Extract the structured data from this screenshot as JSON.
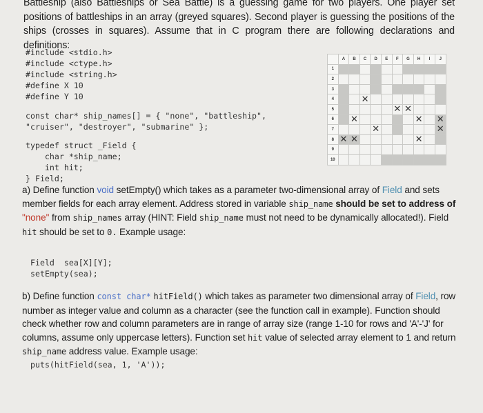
{
  "intro": [
    {
      "t": "Battleship (also Battleships or Sea Battle) is a guessing game for two players. One player set positions of battleships in an array (greyed squares). Second player is guessing the positions of the ships (crosses in squares). Assume that in C program there are following declarations and definitions:",
      "c": ""
    }
  ],
  "code_includes": "#include <stdio.h>\n#include <ctype.h>\n#include <string.h>\n#define X 10\n#define Y 10",
  "code_names": "const char* ship_names[] = { \"none\", \"battleship\",\n\"cruiser\", \"destroyer\", \"submarine\" };",
  "code_struct": "typedef struct _Field {\n    char *ship_name;\n    int hit;\n} Field;",
  "part_a": [
    {
      "t": "a) Define function ",
      "c": ""
    },
    {
      "t": "void",
      "c": "kw"
    },
    {
      "t": " setEmpty() which takes as a parameter two-dimensional array of ",
      "c": ""
    },
    {
      "t": "Field",
      "c": "ty"
    },
    {
      "t": " and sets member fields for each array element. Address stored in variable ",
      "c": ""
    },
    {
      "t": "ship_name",
      "c": "mono"
    },
    {
      "t": " should be set to address of",
      "c": "b"
    },
    {
      "t": " \"none\"",
      "c": "red"
    },
    {
      "t": " from ",
      "c": ""
    },
    {
      "t": "ship_names",
      "c": "mono"
    },
    {
      "t": " array (HINT: Field ",
      "c": ""
    },
    {
      "t": "ship_name",
      "c": "mono"
    },
    {
      "t": " must not need to be dynamically allocated!). Field ",
      "c": ""
    },
    {
      "t": "hit",
      "c": "mono"
    },
    {
      "t": " should be set to ",
      "c": ""
    },
    {
      "t": "0.",
      "c": "mono"
    },
    {
      "t": "  Example usage:",
      "c": ""
    }
  ],
  "code_a": "Field  sea[X][Y];\nsetEmpty(sea);",
  "part_b": [
    {
      "t": "b) Define function ",
      "c": ""
    },
    {
      "t": "const char*",
      "c": "mono kw"
    },
    {
      "t": " ",
      "c": ""
    },
    {
      "t": "hitField()",
      "c": "mono"
    },
    {
      "t": " which takes as parameter two dimensional array of ",
      "c": ""
    },
    {
      "t": "Field",
      "c": "ty"
    },
    {
      "t": ", row number as integer value and column as a character (see the function call in example). Function should check whether row and column parameters are in range of array size (range 1-10 for rows and 'A'-'J' for columns, assume only uppercase letters). Function set ",
      "c": ""
    },
    {
      "t": "hit",
      "c": "mono"
    },
    {
      "t": " value of selected array element to 1 and return ",
      "c": ""
    },
    {
      "t": "ship_name",
      "c": "mono"
    },
    {
      "t": " address value. Example usage:",
      "c": ""
    }
  ],
  "code_b": "puts(hitField(sea, 1, 'A'));",
  "board": {
    "columns": [
      "A",
      "B",
      "C",
      "D",
      "E",
      "F",
      "G",
      "H",
      "I",
      "J"
    ],
    "rows": [
      "1",
      "2",
      "3",
      "4",
      "5",
      "6",
      "7",
      "8",
      "9",
      "10"
    ],
    "ships": [
      "A1",
      "B1",
      "D1",
      "D2",
      "D3",
      "G1",
      "H1",
      "I1",
      "J1",
      "A3",
      "A4",
      "A5",
      "A6",
      "F3",
      "G3",
      "H3",
      "J3",
      "J4",
      "F6",
      "F7",
      "J6",
      "J7",
      "J8",
      "A8",
      "B8",
      "E10",
      "F10",
      "G10",
      "H10",
      "I10",
      "J10"
    ],
    "hits": [
      "C4",
      "F5",
      "G5",
      "B6",
      "H6",
      "J6",
      "D7",
      "J7",
      "A8",
      "B8",
      "H8"
    ],
    "ship_color": "#c8c8c5"
  }
}
